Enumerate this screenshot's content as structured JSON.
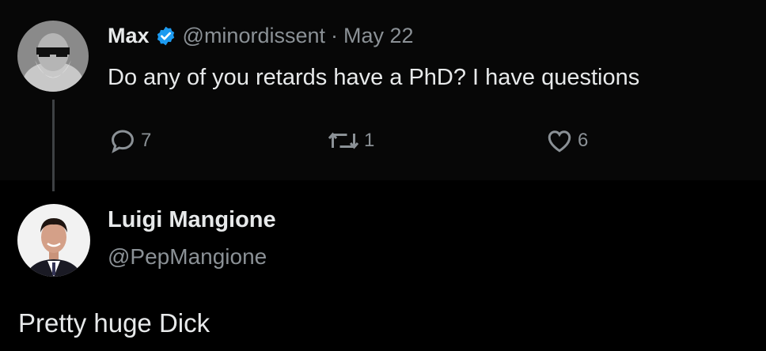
{
  "tweet": {
    "author_name": "Max",
    "author_handle": "@minordissent",
    "separator": "·",
    "date": "May 22",
    "text": "Do any of you retards have a PhD? I have questions",
    "reply_count": "7",
    "retweet_count": "1",
    "like_count": "6"
  },
  "reply": {
    "author_name": "Luigi Mangione",
    "author_handle": "@PepMangione",
    "text": "Pretty huge Dick"
  },
  "colors": {
    "background": "#000000",
    "text_primary": "#e7e9ea",
    "text_secondary": "#8b9196",
    "verified_badge": "#1d9bf0"
  },
  "icons": {
    "verified": "verified-badge-icon",
    "reply": "reply-bubble-icon",
    "retweet": "retweet-icon",
    "like": "heart-icon"
  }
}
